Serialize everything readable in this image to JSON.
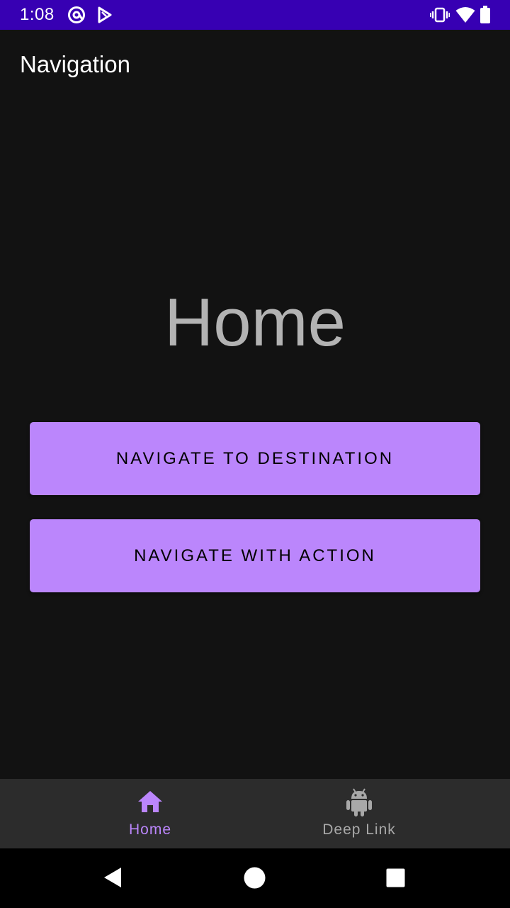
{
  "status_bar": {
    "time": "1:08",
    "background": "#3700b3",
    "icons": [
      "at-sign-notification-icon",
      "play-store-notification-icon",
      "vibrate-icon",
      "wifi-icon",
      "battery-icon"
    ]
  },
  "app_bar": {
    "title": "Navigation"
  },
  "main": {
    "heading": "Home",
    "buttons": [
      {
        "label": "NAVIGATE TO DESTINATION"
      },
      {
        "label": "NAVIGATE WITH ACTION"
      }
    ],
    "button_color": "#bb86fc"
  },
  "bottom_nav": {
    "items": [
      {
        "label": "Home",
        "icon": "home-icon",
        "selected": true,
        "color": "#bb86fc"
      },
      {
        "label": "Deep Link",
        "icon": "android-icon",
        "selected": false,
        "color": "#a8a8a8"
      }
    ]
  },
  "system_nav": {
    "icons": [
      "back-icon",
      "home-circle-icon",
      "recents-icon"
    ]
  }
}
